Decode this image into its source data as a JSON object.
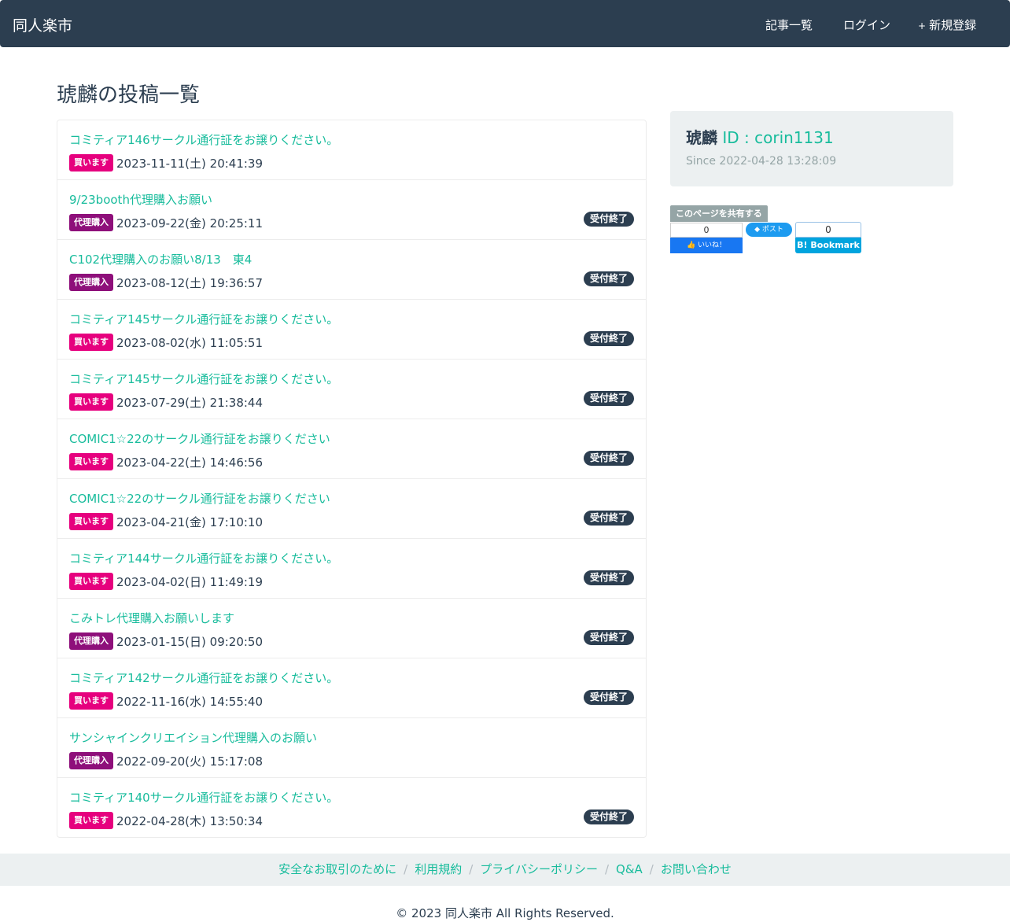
{
  "navbar": {
    "brand": "同人楽市",
    "links": [
      {
        "icon": "list-icon",
        "glyph": "",
        "label": "記事一覧"
      },
      {
        "icon": "login-icon",
        "glyph": "",
        "label": "ログイン"
      },
      {
        "icon": "plus-icon",
        "glyph": "+",
        "label": "新規登録"
      }
    ]
  },
  "page": {
    "title": "琥麟の投稿一覧"
  },
  "posts": [
    {
      "title": "コミティア146サークル通行証をお譲りください。",
      "tag": "買います",
      "tag_type": "buy",
      "date": "2023-11-11(土) 20:41:39",
      "status": ""
    },
    {
      "title": "9/23booth代理購入お願い",
      "tag": "代理購入",
      "tag_type": "proxy",
      "date": "2023-09-22(金) 20:25:11",
      "status": "受付終了"
    },
    {
      "title": "C102代理購入のお願い8/13　東4",
      "tag": "代理購入",
      "tag_type": "proxy",
      "date": "2023-08-12(土) 19:36:57",
      "status": "受付終了"
    },
    {
      "title": "コミティア145サークル通行証をお譲りください。",
      "tag": "買います",
      "tag_type": "buy",
      "date": "2023-08-02(水) 11:05:51",
      "status": "受付終了"
    },
    {
      "title": "コミティア145サークル通行証をお譲りください。",
      "tag": "買います",
      "tag_type": "buy",
      "date": "2023-07-29(土) 21:38:44",
      "status": "受付終了"
    },
    {
      "title": "COMIC1☆22のサークル通行証をお譲りください",
      "tag": "買います",
      "tag_type": "buy",
      "date": "2023-04-22(土) 14:46:56",
      "status": "受付終了"
    },
    {
      "title": "COMIC1☆22のサークル通行証をお譲りください",
      "tag": "買います",
      "tag_type": "buy",
      "date": "2023-04-21(金) 17:10:10",
      "status": "受付終了"
    },
    {
      "title": "コミティア144サークル通行証をお譲りください。",
      "tag": "買います",
      "tag_type": "buy",
      "date": "2023-04-02(日) 11:49:19",
      "status": "受付終了"
    },
    {
      "title": "こみトレ代理購入お願いします",
      "tag": "代理購入",
      "tag_type": "proxy",
      "date": "2023-01-15(日) 09:20:50",
      "status": "受付終了"
    },
    {
      "title": "コミティア142サークル通行証をお譲りください。",
      "tag": "買います",
      "tag_type": "buy",
      "date": "2022-11-16(水) 14:55:40",
      "status": "受付終了"
    },
    {
      "title": "サンシャインクリエイション代理購入のお願い",
      "tag": "代理購入",
      "tag_type": "proxy",
      "date": "2022-09-20(火) 15:17:08",
      "status": ""
    },
    {
      "title": "コミティア140サークル通行証をお譲りください。",
      "tag": "買います",
      "tag_type": "buy",
      "date": "2022-04-28(木) 13:50:34",
      "status": "受付終了"
    }
  ],
  "profile": {
    "icon": "user-icon",
    "glyph": "",
    "name": "琥麟",
    "id_text": " ID : corin1131",
    "since_icon": "calendar-icon",
    "since_glyph": "",
    "since": "Since 2022-04-28 13:28:09"
  },
  "share": {
    "label": "このページを共有する",
    "facebook": {
      "count": "0",
      "label": "いいね！"
    },
    "twitter": {
      "label": "ポスト"
    },
    "hatena": {
      "count": "0",
      "label": "B! Bookmark"
    }
  },
  "footer": {
    "links": [
      "安全なお取引のために",
      "利用規約",
      "プライバシーポリシー",
      "Q&A",
      "お問い合わせ"
    ],
    "separator": "/",
    "copyright": "© 2023 同人楽市 All Rights Reserved."
  },
  "colors": {
    "navbar": "#2c3e50",
    "link": "#18bc9c",
    "tag_buy": "#e6007e",
    "tag_proxy": "#8e0f7a",
    "badge_closed": "#2c3e50"
  }
}
